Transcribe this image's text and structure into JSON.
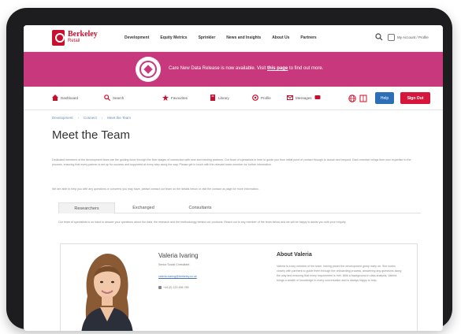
{
  "header": {
    "logo_line1": "Berkeley",
    "logo_line2": "Retail",
    "nav": [
      "Development",
      "Equity Metrics",
      "Sprinkler",
      "News and Insights",
      "About Us",
      "Partners"
    ],
    "account_label": "My Account / Profile"
  },
  "banner": {
    "text_before": "Care New Data Release is now available. Visit",
    "link_text": "this page",
    "text_after": "to find out more."
  },
  "toolbar": {
    "items": [
      "Dashboard",
      "Search",
      "Favourites",
      "Library",
      "Profile",
      "Messages"
    ],
    "login_label": "Help",
    "signout_label": "Sign Out"
  },
  "breadcrumb": [
    "Development",
    "Connect",
    "Meet the Team"
  ],
  "page": {
    "title": "Meet the Team",
    "paragraph1": "Dedicated members of the development team are the guiding force through the finer stages of connection with new and existing partners. Our team of specialists is here to guide you from initial point of contact through to launch and beyond. Each member brings their own expertise to the process, ensuring that every partner is set up for success and supported at every step along the way. Please get in touch with the relevant team member for further information.",
    "paragraph2": "We are able to help you with any questions or concerns you may have, please contact our team on the details below or visit the contact us page for more information."
  },
  "tabs": [
    {
      "label": "Researchers",
      "active": true
    },
    {
      "label": "Exchanged",
      "active": false
    },
    {
      "label": "Consultants",
      "active": false
    }
  ],
  "tab_intro": "Our team of specialists is on hand to answer your questions about the data, the research and the methodology behind our products. Reach out to any member of the team below and we will be happy to assist you with your enquiry.",
  "profile": {
    "name": "Valeria Ivaring",
    "role": "Senior Social Consultant",
    "email": "valeria.ivaring@berkeley.co.uk",
    "phone": "+44 (0) 123 456 789",
    "about_title": "About Valeria",
    "about_text": "Valeria is a key member of the team, having joined the development group early on. She works closely with partners to guide them through the onboarding process, answering any questions along the way and ensuring that every requirement is met. With a background in data analysis, Valeria brings a wealth of knowledge to every conversation and is always happy to help."
  },
  "colors": {
    "brand_red": "#c8102e",
    "banner_pink": "#c8387c",
    "button_blue": "#2d6fb7",
    "signout_red": "#d6163a"
  }
}
